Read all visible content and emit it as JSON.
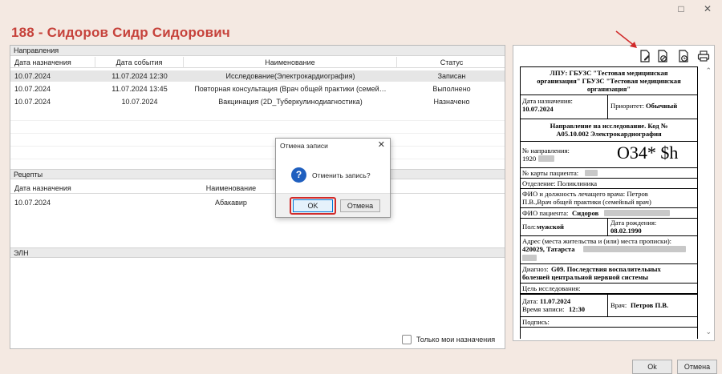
{
  "window": {
    "title": "188 - Сидоров Сидр Сидорович",
    "minimize_glyph": "□",
    "close_glyph": "✕"
  },
  "directions": {
    "section_label": "Направления",
    "columns": [
      "Дата назначения",
      "Дата события",
      "Наименование",
      "Статус"
    ],
    "rows": [
      {
        "date": "10.07.2024",
        "event": "11.07.2024 12:30",
        "name": "Исследование(Электрокардиография)",
        "status": "Записан"
      },
      {
        "date": "10.07.2024",
        "event": "11.07.2024 13:45",
        "name": "Повторная консультация (Врач общей практики (семей…",
        "status": "Выполнено"
      },
      {
        "date": "10.07.2024",
        "event": "10.07.2024",
        "name": "Вакцинация (2D_Туберкулинодиагностика)",
        "status": "Назначено"
      }
    ]
  },
  "recipes": {
    "section_label": "Рецепты",
    "columns": [
      "Дата назначения",
      "Наименование"
    ],
    "rows": [
      {
        "date": "10.07.2024",
        "name": "Абакавир"
      }
    ]
  },
  "eln": {
    "section_label": "ЭЛН"
  },
  "only_mine": {
    "label": "Только мои назначения"
  },
  "footer": {
    "ok_label": "Ok",
    "cancel_label": "Отмена"
  },
  "modal": {
    "title": "Отмена записи",
    "message": "Отменить запись?",
    "ok_label": "OK",
    "cancel_label": "Отмена",
    "close_glyph": "✕",
    "icon_glyph": "?"
  },
  "document": {
    "org_line1": "ЛПУ: ГБУЗС \"Тестовая медицинская",
    "org_line2": "организация\" ГБУЗС \"Тестовая медицинская",
    "org_line3": "организация\"",
    "assign_label": "Дата назначения:",
    "assign_value": "10.07.2024",
    "priority_label": "Приоритет:",
    "priority_value": "Обычный",
    "heading_line1": "Направление на исследование. Код №",
    "heading_line2": "A05.10.002 Электрокардиография",
    "number_label": "№ направления:",
    "number_value": "1920",
    "barcode_text": "O34* $h",
    "card_label": "№ карты пациента:",
    "department": "Отделение: Поликлиника",
    "doctor_line1": "ФИО и должность лечащего врача: Петров",
    "doctor_line2": "П.В.,Врач общей практики (семейный врач)",
    "patient_label": "ФИО пациента:",
    "patient_value": "Сидоров",
    "sex_label": "Пол:",
    "sex_value": "мужской",
    "birth_label": "Дата рождения:",
    "birth_value": "08.02.1990",
    "address_label": "Адрес (места жительства и (или) места прописки):",
    "address_value": "420029, Татарста",
    "diagnosis_label": "Диагноз:",
    "diagnosis_line1": "G09. Последствия воспалительных",
    "diagnosis_line2": "болезней центральной нервной системы",
    "purpose_label": "Цель исследования:",
    "date_label": "Дата:",
    "date_value": "11.07.2024",
    "time_label": "Время записи:",
    "time_value": "12:30",
    "doctor_label": "Врач:",
    "doctor_value": "Петров П.В.",
    "signature_label": "Подпись:"
  },
  "colors": {
    "title": "#c6423b",
    "background": "#f4e9e2",
    "arrow": "#d12a2a",
    "info_icon": "#1f5fbf"
  },
  "icons": {
    "edit": "edit-document-icon",
    "cancel_doc": "cancel-document-icon",
    "refresh_doc": "refresh-document-icon",
    "print": "printer-icon"
  }
}
